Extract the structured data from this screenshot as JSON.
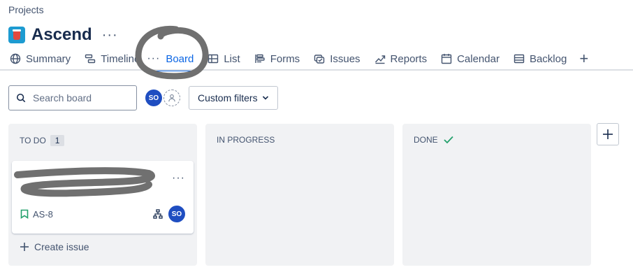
{
  "breadcrumb": "Projects",
  "project": {
    "name": "Ascend",
    "more": "···",
    "logo": "project-logo-icon"
  },
  "tabs": [
    {
      "label": "Summary",
      "icon": "globe-icon"
    },
    {
      "label": "Timeline",
      "icon": "timeline-icon"
    },
    {
      "label": "Board",
      "icon": "board-icon",
      "active": true
    },
    {
      "label": "List",
      "icon": "list-icon"
    },
    {
      "label": "Forms",
      "icon": "forms-icon"
    },
    {
      "label": "Issues",
      "icon": "issues-icon"
    },
    {
      "label": "Reports",
      "icon": "reports-icon"
    },
    {
      "label": "Calendar",
      "icon": "calendar-icon"
    },
    {
      "label": "Backlog",
      "icon": "backlog-icon"
    }
  ],
  "tab_more": "···",
  "add_tab": "+",
  "search": {
    "placeholder": "Search board"
  },
  "user": {
    "initials": "SO"
  },
  "filters": {
    "label": "Custom filters"
  },
  "columns": [
    {
      "title": "TO DO",
      "count": "1"
    },
    {
      "title": "IN PROGRESS"
    },
    {
      "title": "DONE"
    }
  ],
  "card": {
    "key": "AS-8",
    "assignee_initials": "SO",
    "more": "···"
  },
  "create_issue": "Create issue",
  "add_column": "+",
  "colors": {
    "accent": "#0c66e4",
    "column_bg": "#f1f2f4",
    "avatar": "#1f4ec1",
    "done_check": "#22a06b",
    "story_green": "#22a06b",
    "annotation": "#707070"
  }
}
